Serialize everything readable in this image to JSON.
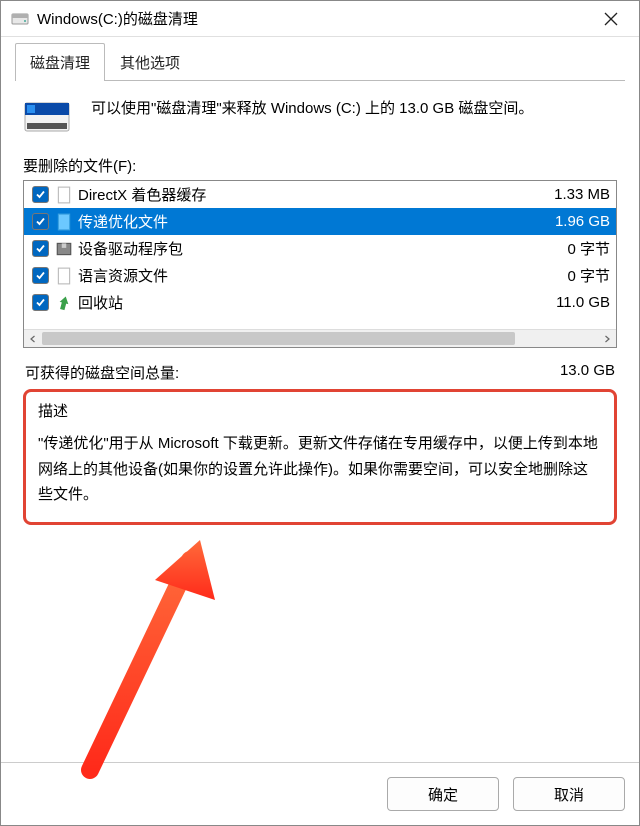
{
  "window": {
    "title": "Windows(C:)的磁盘清理"
  },
  "tabs": [
    {
      "label": "磁盘清理",
      "active": true
    },
    {
      "label": "其他选项",
      "active": false
    }
  ],
  "intro": {
    "text": "可以使用\"磁盘清理\"来释放 Windows (C:) 上的 13.0 GB 磁盘空间。"
  },
  "files": {
    "section_label": "要删除的文件(F):",
    "items": [
      {
        "checked": true,
        "icon": "file-icon",
        "name": "DirectX 着色器缓存",
        "size": "1.33 MB",
        "selected": false
      },
      {
        "checked": true,
        "icon": "file-blue-icon",
        "name": "传递优化文件",
        "size": "1.96 GB",
        "selected": true
      },
      {
        "checked": true,
        "icon": "package-icon",
        "name": "设备驱动程序包",
        "size": "0 字节",
        "selected": false
      },
      {
        "checked": true,
        "icon": "file-icon",
        "name": "语言资源文件",
        "size": "0 字节",
        "selected": false
      },
      {
        "checked": true,
        "icon": "recycle-icon",
        "name": "回收站",
        "size": "11.0 GB",
        "selected": false
      }
    ]
  },
  "total": {
    "label": "可获得的磁盘空间总量:",
    "value": "13.0 GB"
  },
  "description": {
    "title": "描述",
    "body": "\"传递优化\"用于从 Microsoft 下载更新。更新文件存储在专用缓存中，以便上传到本地网络上的其他设备(如果你的设置允许此操作)。如果你需要空间，可以安全地删除这些文件。"
  },
  "footer": {
    "ok": "确定",
    "cancel": "取消"
  }
}
